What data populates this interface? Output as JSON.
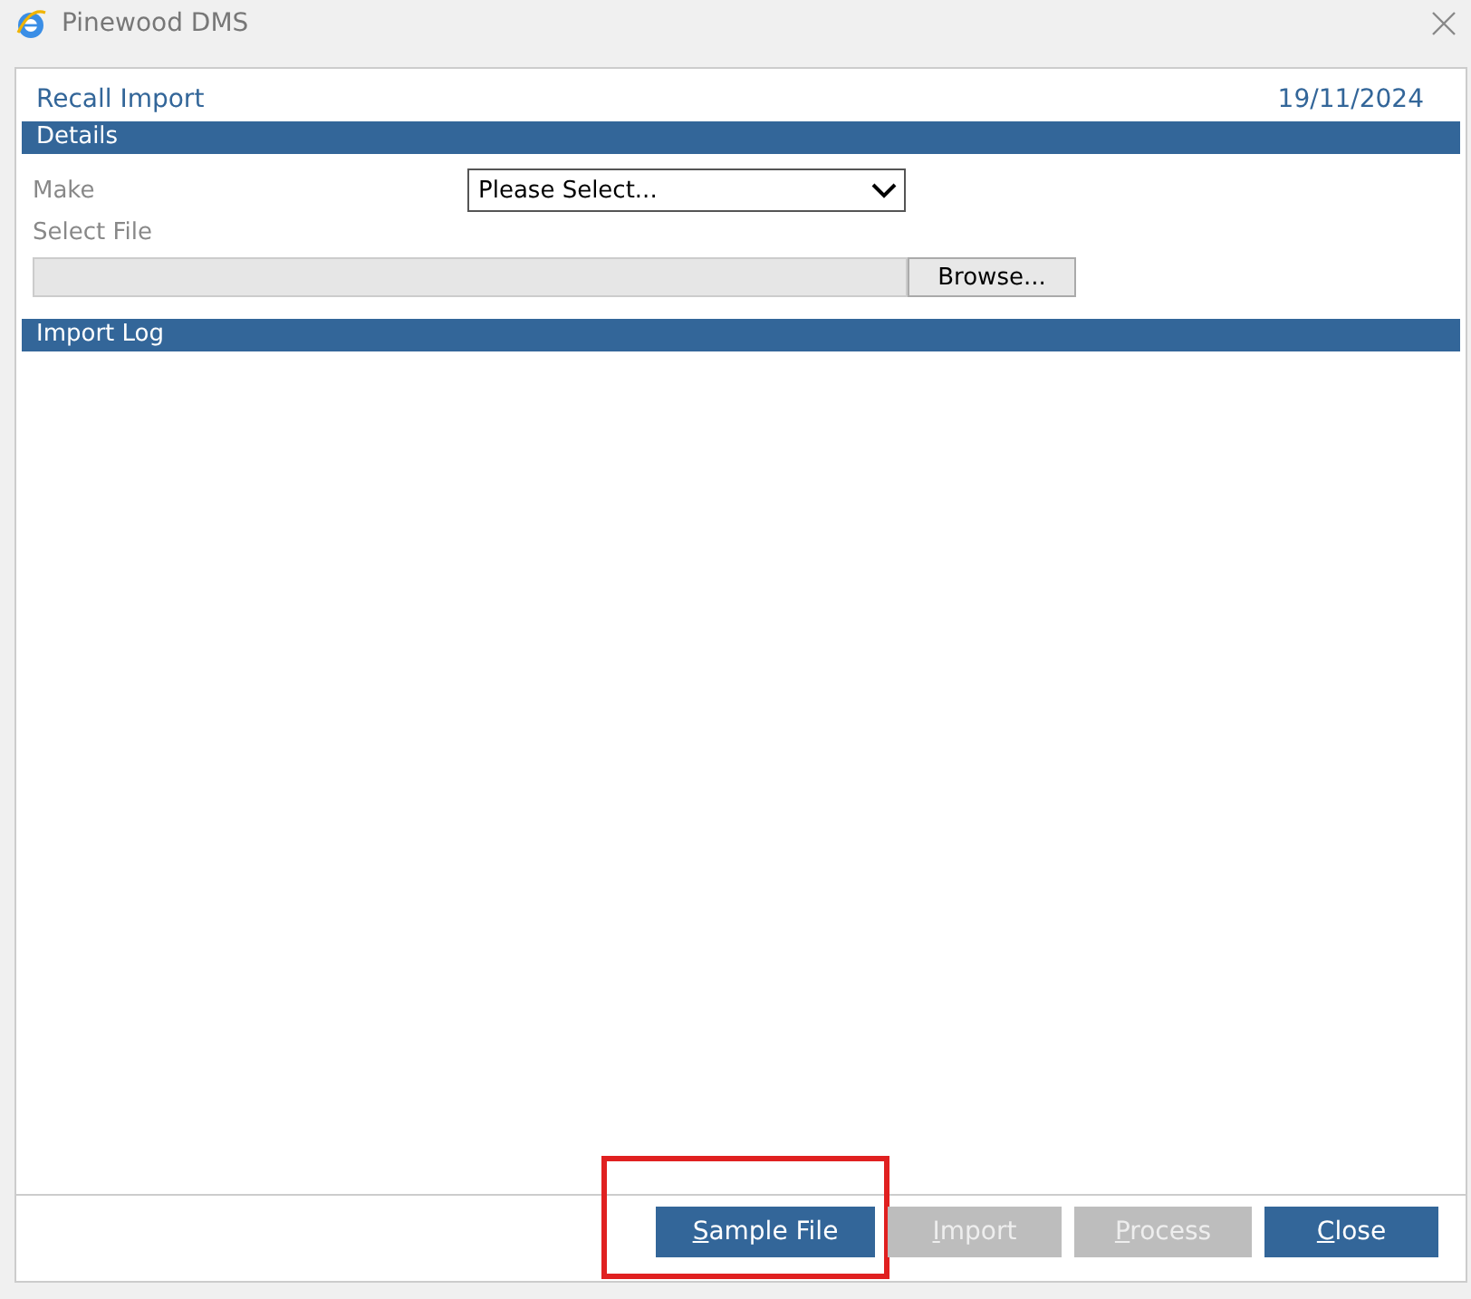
{
  "window": {
    "title": "Pinewood DMS"
  },
  "form": {
    "title": "Recall Import",
    "date": "19/11/2024"
  },
  "details": {
    "heading": "Details",
    "make_label": "Make",
    "make_value": "Please Select...",
    "file_label": "Select File",
    "browse": "Browse..."
  },
  "import_log": {
    "heading": "Import Log"
  },
  "buttons": [
    {
      "label": "Sample File",
      "disabled": false,
      "highlighted": true
    },
    {
      "label": "Import",
      "disabled": true,
      "highlighted": false
    },
    {
      "label": "Process",
      "disabled": true,
      "highlighted": false
    },
    {
      "label": "Close",
      "disabled": false,
      "highlighted": false
    }
  ]
}
